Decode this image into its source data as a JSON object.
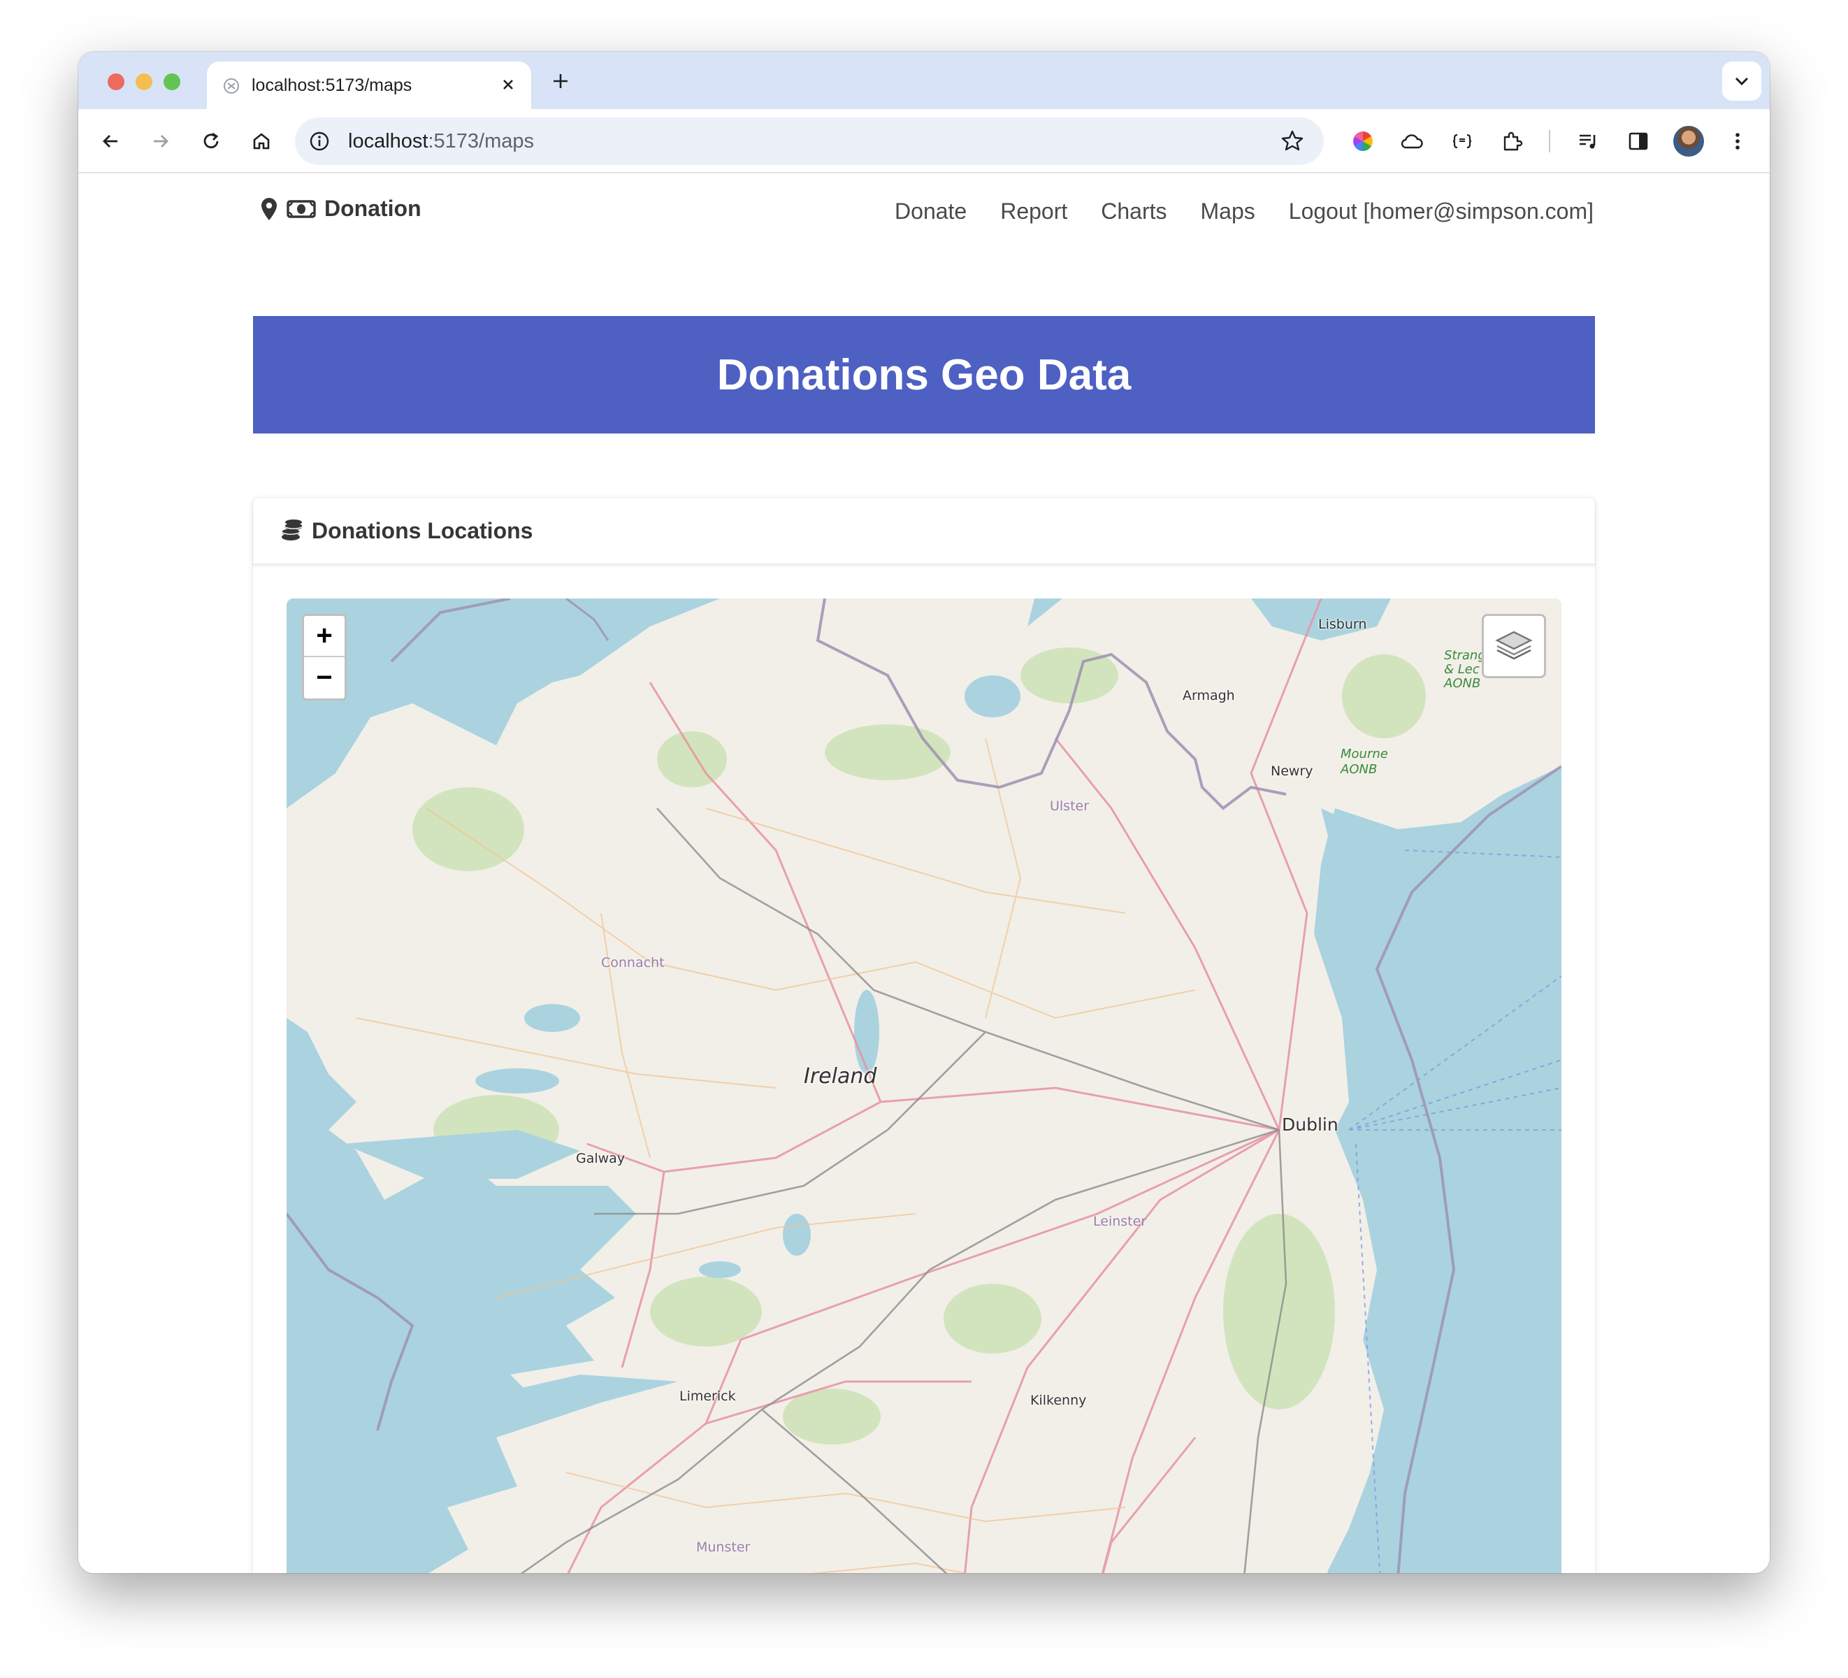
{
  "browser": {
    "tab_title": "localhost:5173/maps",
    "url_host": "localhost",
    "url_rest": ":5173/maps"
  },
  "nav": {
    "brand": "Donation",
    "links": [
      "Donate",
      "Report",
      "Charts",
      "Maps",
      "Logout [homer@simpson.com]"
    ]
  },
  "hero": {
    "title": "Donations Geo Data"
  },
  "card": {
    "title": "Donations Locations"
  },
  "map": {
    "zoom_in": "+",
    "zoom_out": "−",
    "labels": {
      "country": "Ireland",
      "capital": "Dublin",
      "cities": [
        "Lisburn",
        "Armagh",
        "Newry",
        "Galway",
        "Limerick",
        "Kilkenny"
      ],
      "regions": [
        "Ulster",
        "Connacht",
        "Leinster",
        "Munster"
      ],
      "parks": [
        "Strang & Lec AONB",
        "Mourne AONB"
      ]
    },
    "colors": {
      "sea": "#aad3df",
      "land": "#f2efe9",
      "border": "#9e8fb0",
      "road": "#e892a2"
    }
  }
}
